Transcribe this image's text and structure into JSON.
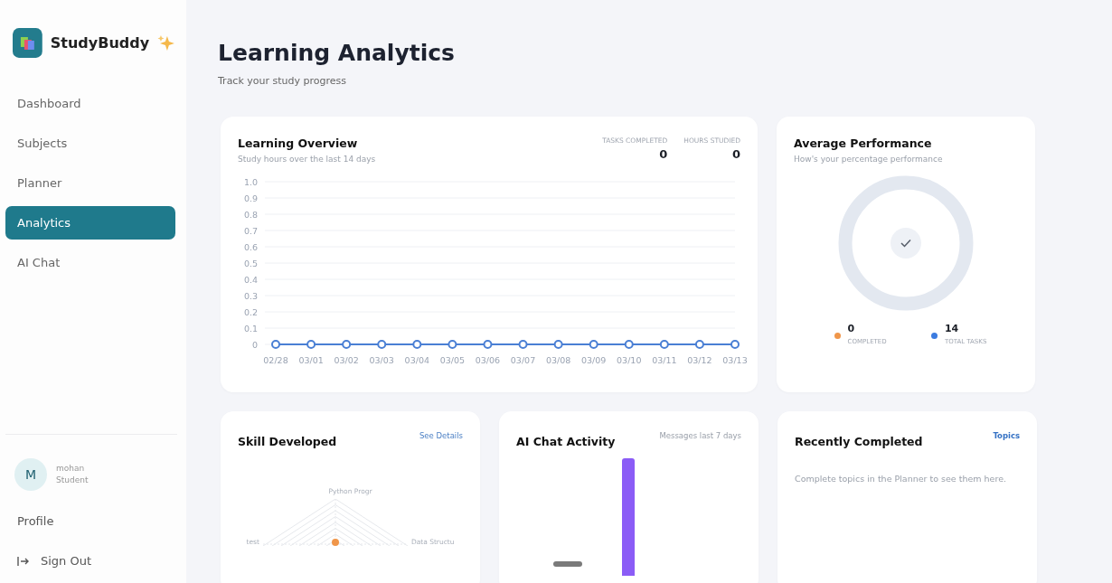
{
  "app": {
    "name": "StudyBuddy"
  },
  "sidebar": {
    "items": [
      {
        "label": "Dashboard",
        "selected": false
      },
      {
        "label": "Subjects",
        "selected": false
      },
      {
        "label": "Planner",
        "selected": false
      },
      {
        "label": "Analytics",
        "selected": true
      },
      {
        "label": "AI Chat",
        "selected": false
      }
    ],
    "user": {
      "initial": "M",
      "name": "mohan",
      "role": "Student"
    },
    "profile": "Profile",
    "sign_out": "Sign Out"
  },
  "page": {
    "title": "Learning Analytics",
    "subtitle": "Track your study progress"
  },
  "overview": {
    "title": "Learning Overview",
    "subtitle": "Study hours over the last 14 days",
    "stats": [
      {
        "label": "TASKS COMPLETED",
        "value": "0"
      },
      {
        "label": "HOURS STUDIED",
        "value": "0"
      }
    ],
    "chart_data": {
      "type": "line",
      "categories": [
        "02/28",
        "03/01",
        "03/02",
        "03/03",
        "03/04",
        "03/05",
        "03/06",
        "03/07",
        "03/08",
        "03/09",
        "03/10",
        "03/11",
        "03/12",
        "03/13"
      ],
      "series": [
        {
          "color": "#4a7fd4",
          "marker": true,
          "values": [
            0,
            0,
            0,
            0,
            0,
            0,
            0,
            0,
            0,
            0,
            0,
            0,
            0,
            0
          ]
        }
      ],
      "ylim": [
        0,
        1
      ],
      "grid": true,
      "yticks": [
        {
          "value": 0,
          "label": "0"
        },
        {
          "value": 0.1,
          "label": "0.1"
        },
        {
          "value": 0.2,
          "label": "0.2"
        },
        {
          "value": 0.3,
          "label": "0.3"
        },
        {
          "value": 0.4,
          "label": "0.4"
        },
        {
          "value": 0.5,
          "label": "0.5"
        },
        {
          "value": 0.6,
          "label": "0.6"
        },
        {
          "value": 0.7,
          "label": "0.7"
        },
        {
          "value": 0.8,
          "label": "0.8"
        },
        {
          "value": 0.9,
          "label": "0.9"
        },
        {
          "value": 1,
          "label": "1.0"
        }
      ]
    }
  },
  "performance": {
    "title": "Average Performance",
    "subtitle": "How's your percentage performance",
    "legend": [
      {
        "value": "0",
        "label": "COMPLETED",
        "color": "#f0964a"
      },
      {
        "value": "14",
        "label": "TOTAL TASKS",
        "color": "#3b7be0"
      }
    ]
  },
  "skills": {
    "title": "Skill Developed",
    "link": "See Details",
    "axes": [
      "Python Progr",
      "Data Structu",
      "test"
    ]
  },
  "chat_activity": {
    "title": "AI Chat Activity",
    "note": "Messages last 7 days"
  },
  "recent": {
    "title": "Recently Completed",
    "link": "Topics",
    "empty": "Complete topics in the Planner to see them here."
  }
}
